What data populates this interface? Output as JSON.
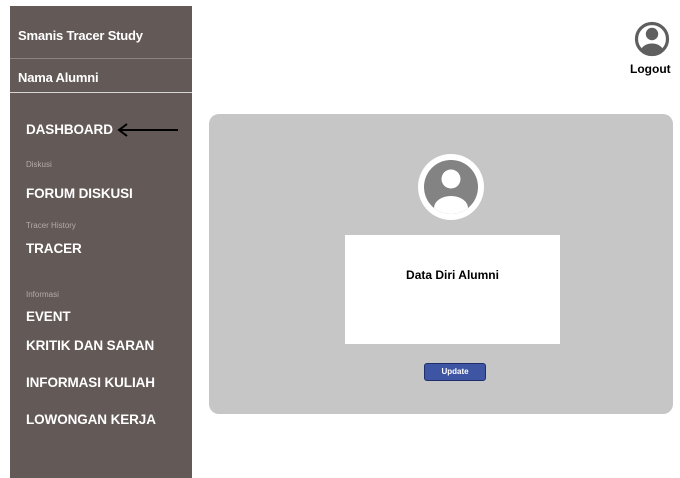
{
  "sidebar": {
    "brand": "Smanis Tracer Study",
    "alumni_name": "Nama Alumni",
    "nav": {
      "dashboard": "DASHBOARD",
      "diskusi_label": "Diskusi",
      "forum": "FORUM DISKUSI",
      "tracer_label": "Tracer History",
      "tracer": "TRACER",
      "informasi_label": "Informasi",
      "event": "EVENT",
      "kritik": "KRITIK DAN SARAN",
      "kuliah": "INFORMASI KULIAH",
      "loker": "LOWONGAN KERJA"
    }
  },
  "header": {
    "logout_label": "Logout",
    "avatar_icon": "user-avatar-icon"
  },
  "main": {
    "card_title": "Data Diri Alumni",
    "update_label": "Update"
  },
  "colors": {
    "sidebar_bg": "#635957",
    "card_bg": "#c6c6c6",
    "button_bg": "#3d55a3"
  }
}
